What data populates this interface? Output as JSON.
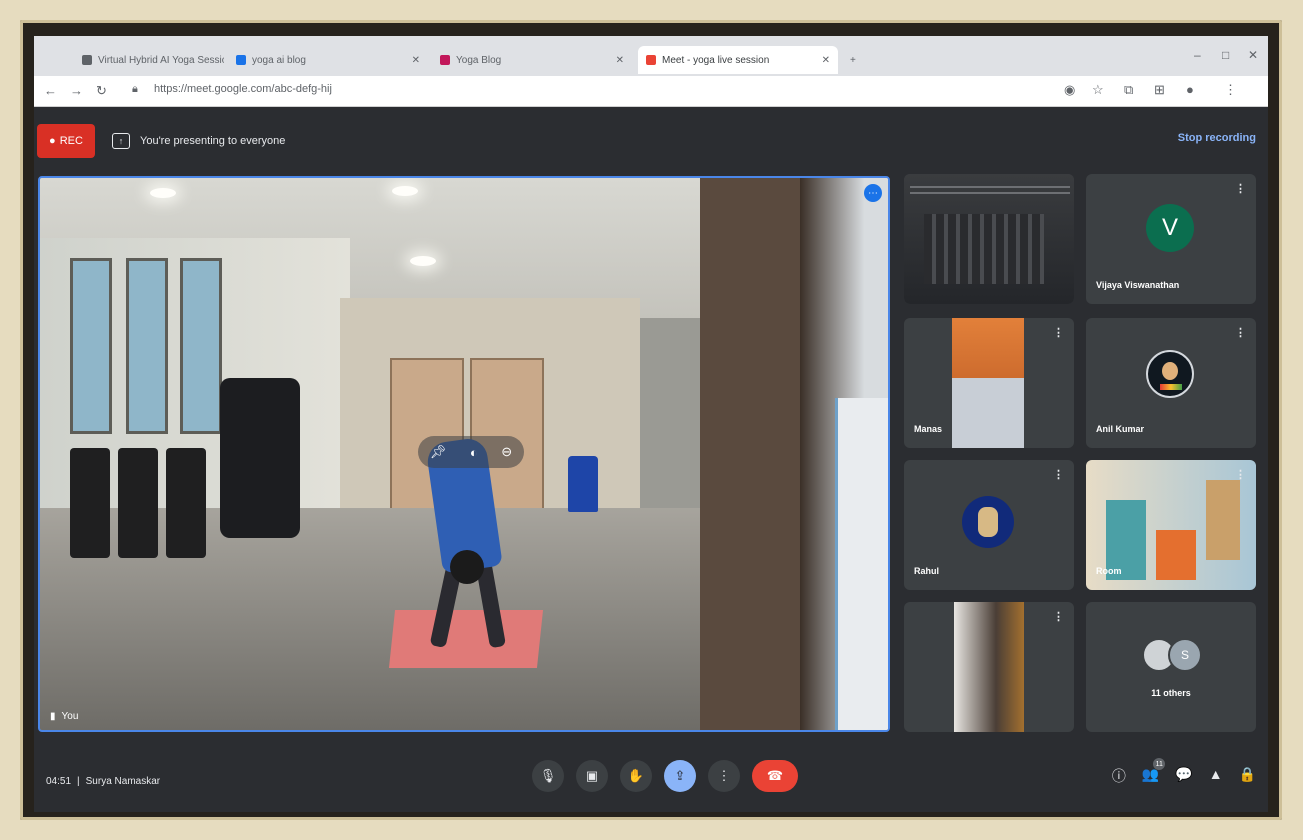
{
  "browser": {
    "tabs": [
      {
        "label": "Virtual Hybrid AI Yoga Session",
        "fav": "#5f6368"
      },
      {
        "label": "yoga ai blog",
        "fav": "#1a73e8"
      },
      {
        "label": "Yoga Blog",
        "fav": "#c2185b"
      },
      {
        "label": "Meet - yoga live session",
        "fav": "#ea4335"
      }
    ],
    "new_tab": "+",
    "url": "https://meet.google.com/abc-defg-hij",
    "window_controls": [
      "–",
      "□",
      "✕"
    ]
  },
  "meet": {
    "rec_label": "REC",
    "recording_notice": "You're presenting to everyone",
    "stop_recording": "Stop recording",
    "main_name": "You",
    "more_badge": "⋯"
  },
  "tiles": [
    {
      "name": "",
      "kind": "video-dark"
    },
    {
      "name": "Vijaya Viswanathan",
      "kind": "avatar-letter",
      "letter": "V"
    },
    {
      "name": "Manas",
      "kind": "video-orange"
    },
    {
      "name": "Anil Kumar",
      "kind": "avatar-photo"
    },
    {
      "name": "Rahul",
      "kind": "avatar-emblem"
    },
    {
      "name": "Room",
      "kind": "video-room"
    },
    {
      "name": "",
      "kind": "video-strip"
    },
    {
      "name": "11 others",
      "kind": "others",
      "other_initial": "S"
    }
  ],
  "footer": {
    "time": "04:51",
    "separator": "|",
    "meeting_name": "Surya Namaskar"
  },
  "icons": {
    "mic": "🎙",
    "camera": "▣",
    "hand": "✋",
    "present": "⇪",
    "more": "⋮",
    "end": "☎",
    "info": "ⓘ",
    "people": "👥",
    "chat": "💬",
    "activities": "▲",
    "lock": "🔒"
  },
  "people_count": "11"
}
